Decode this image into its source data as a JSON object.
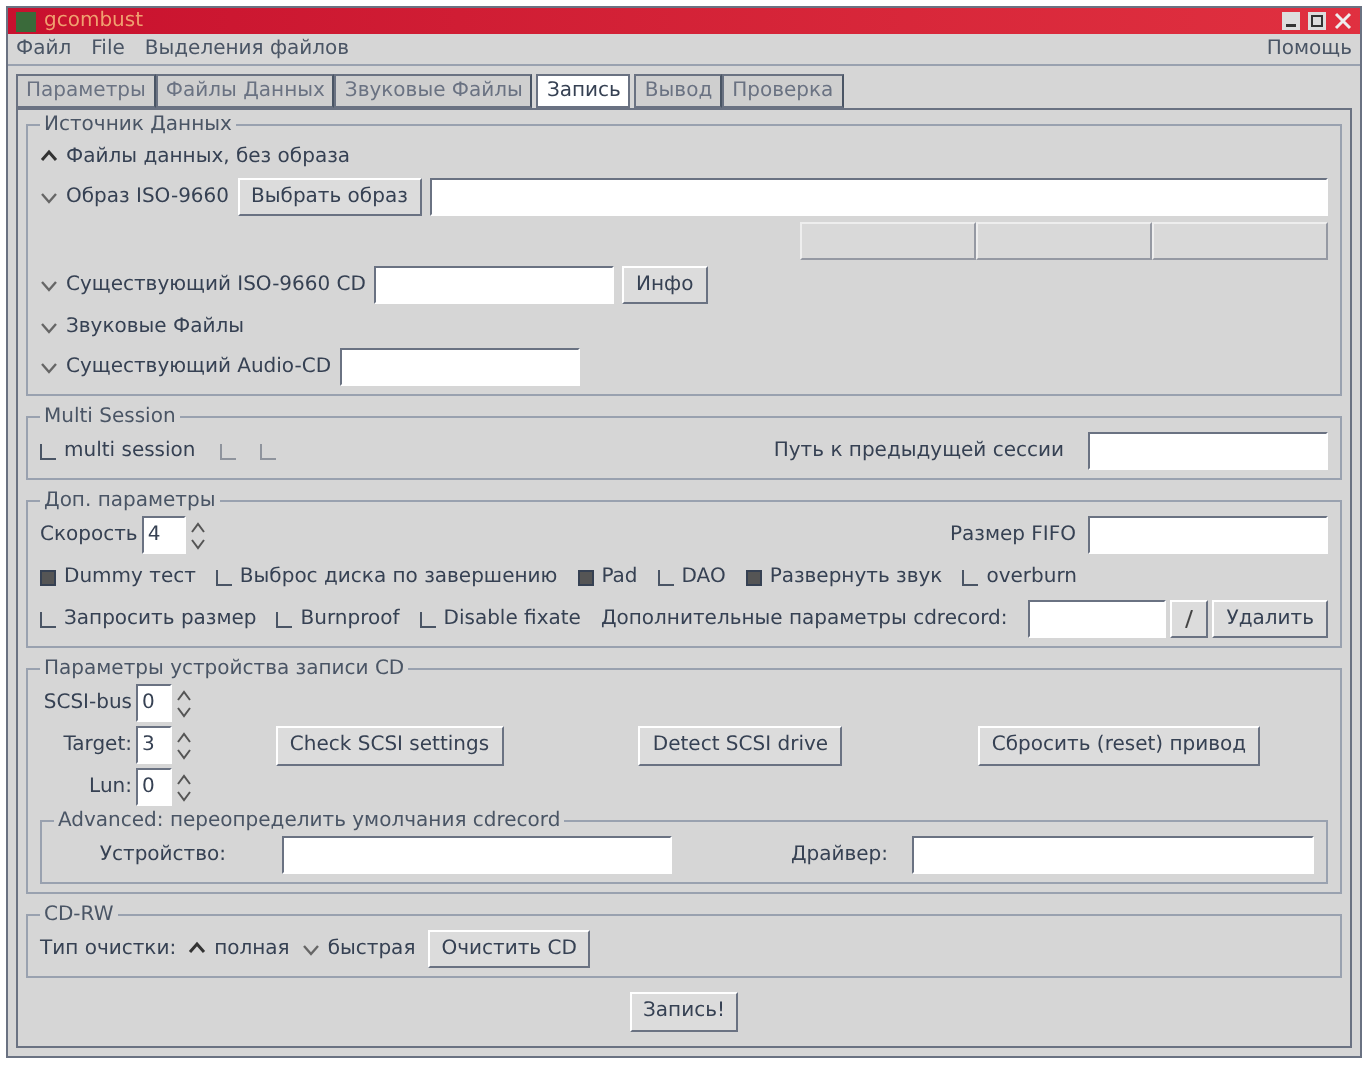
{
  "window": {
    "title": "gcombust"
  },
  "menu": [
    {
      "label": "Файл"
    },
    {
      "label": "File"
    },
    {
      "label": "Выделения файлов"
    }
  ],
  "help_menu": "Помощь",
  "tabs": [
    {
      "label": "Параметры",
      "selected": false
    },
    {
      "label": "Файлы Данных",
      "selected": false
    },
    {
      "label": "Звуковые Файлы",
      "selected": false
    },
    {
      "label": "Запись",
      "selected": true
    },
    {
      "label": "Вывод",
      "selected": false
    },
    {
      "label": "Проверка",
      "selected": false
    }
  ],
  "data_source": {
    "title": "Источник Данных",
    "sources": [
      {
        "kind": "plain",
        "label": "Файлы данных, без образа",
        "selected": true
      },
      {
        "kind": "image",
        "label": "Образ ISO-9660",
        "selected": false,
        "button": "Выбрать образ"
      },
      {
        "kind": "cd",
        "label": "Существующий ISO-9660 CD",
        "selected": false,
        "button": "Инфо"
      },
      {
        "kind": "plain",
        "label": "Звуковые Файлы",
        "selected": false
      },
      {
        "kind": "audio",
        "label": "Существующий Audio-CD",
        "selected": false
      }
    ],
    "image_actions": [
      {
        "disabled": true
      },
      {
        "disabled": true
      },
      {
        "disabled": true
      }
    ]
  },
  "multi_session": {
    "title": "Multi Session",
    "options": [
      {
        "label": "multi session",
        "checked": false,
        "disabled": false
      },
      {
        "checked": false,
        "disabled": true
      },
      {
        "checked": false,
        "disabled": true
      }
    ],
    "path_label": "Путь к предыдущей сессии"
  },
  "extra": {
    "title": "Доп. параметры",
    "speed_label": "Скорость",
    "speed_value": "4",
    "fifo_label": "Размер FIFO",
    "checks_row1": [
      {
        "label": "Dummy тест",
        "checked": true
      },
      {
        "label": "Выброс диска по завершению",
        "checked": false
      },
      {
        "label": "Pad",
        "checked": true
      },
      {
        "label": "DAO",
        "checked": false
      },
      {
        "label": "Развернуть звук",
        "checked": true
      },
      {
        "label": "overburn",
        "checked": false
      }
    ],
    "checks_row2": [
      {
        "label": "Запросить размер",
        "checked": false
      },
      {
        "label": "Burnproof",
        "checked": false
      },
      {
        "label": "Disable fixate",
        "checked": false
      }
    ],
    "extra_label": "Дополнительные параметры cdrecord:",
    "delete_button": "Удалить"
  },
  "device": {
    "title": "Параметры устройства записи CD",
    "spins": [
      {
        "label": "SCSI-bus",
        "value": "0"
      },
      {
        "label": "Target:",
        "value": "3"
      },
      {
        "label": "Lun:",
        "value": "0"
      }
    ],
    "buttons": [
      "Check SCSI settings",
      "Detect SCSI drive",
      "Сбросить (reset) привод"
    ],
    "advanced": {
      "title": "Advanced: переопределить умолчания cdrecord",
      "device_label": "Устройство:",
      "driver_label": "Драйвер:"
    }
  },
  "cdrw": {
    "title": "CD-RW",
    "label": "Тип очистки:",
    "options": [
      {
        "label": "полная",
        "selected": true
      },
      {
        "label": "быстрая",
        "selected": false
      }
    ],
    "button": "Очистить CD"
  },
  "record_button": "Запись!"
}
